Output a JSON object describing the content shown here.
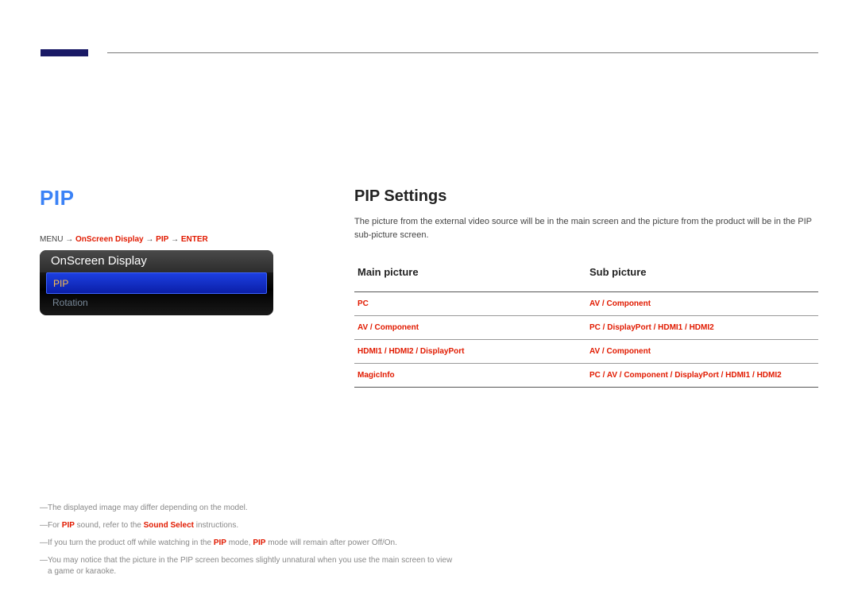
{
  "left": {
    "title": "PIP",
    "breadcrumb_prefix": "MENU ",
    "breadcrumb_arrow": " → ",
    "breadcrumb_item1": "OnScreen Display",
    "breadcrumb_item2": "PIP",
    "breadcrumb_item3": "ENTER",
    "panel_header": "OnScreen Display",
    "menu_selected": "PIP",
    "menu_item2": "Rotation"
  },
  "right": {
    "heading": "PIP Settings",
    "description": "The picture from the external video source will be in the main screen and the picture from the product will be in the PIP sub-picture screen.",
    "col1": "Main picture",
    "col2": "Sub picture",
    "rows": [
      {
        "main": "PC",
        "sub": "AV / Component"
      },
      {
        "main": "AV / Component",
        "sub": "PC / DisplayPort / HDMI1 / HDMI2"
      },
      {
        "main": "HDMI1 / HDMI2 / DisplayPort",
        "sub": "AV / Component"
      },
      {
        "main": "MagicInfo",
        "sub": "PC / AV / Component / DisplayPort / HDMI1 / HDMI2"
      }
    ]
  },
  "notes": {
    "n1": "The displayed image may differ depending on the model.",
    "n2a": "For ",
    "n2b": "PIP",
    "n2c": " sound, refer to the ",
    "n2d": "Sound Select",
    "n2e": " instructions.",
    "n3a": "If you turn the product off while watching in the ",
    "n3b": "PIP",
    "n3c": " mode, ",
    "n3d": "PIP",
    "n3e": " mode will remain after power Off/On.",
    "n4": "You may notice that the picture in the PIP screen becomes slightly unnatural when you use the main screen to view a game or karaoke."
  }
}
